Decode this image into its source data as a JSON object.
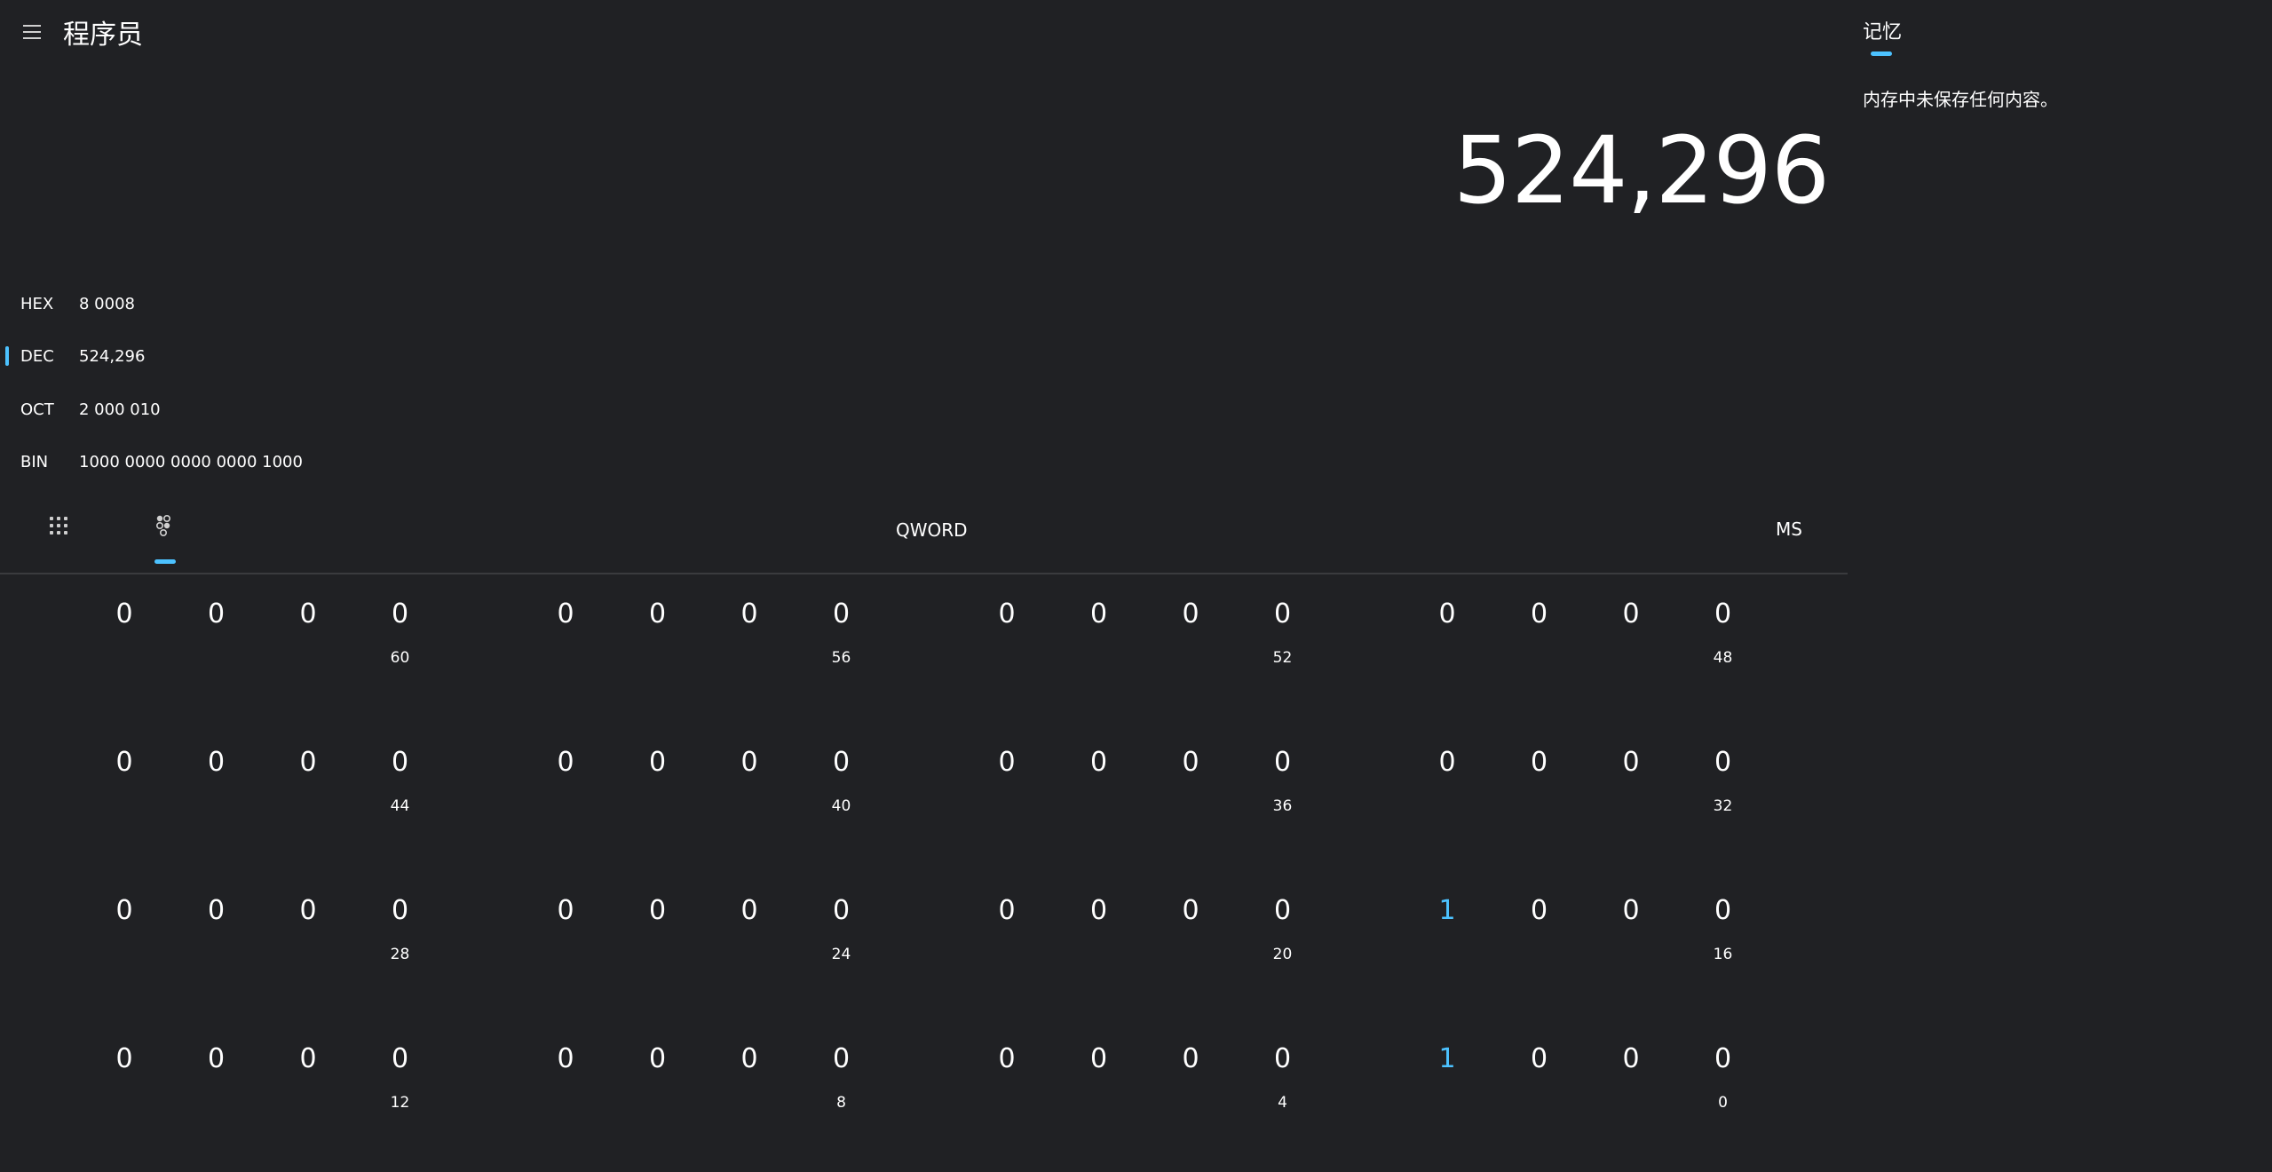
{
  "header": {
    "title": "程序员",
    "menu_icon": "hamburger-menu-icon"
  },
  "display": {
    "value": "524,296"
  },
  "radix": [
    {
      "label": "HEX",
      "value": "8 0008",
      "active": false
    },
    {
      "label": "DEC",
      "value": "524,296",
      "active": true
    },
    {
      "label": "OCT",
      "value": "2 000 010",
      "active": false
    },
    {
      "label": "BIN",
      "value": "1000 0000 0000 0000 1000",
      "active": false
    }
  ],
  "toolbar": {
    "keypad_icon": "full-keypad-icon",
    "bits_icon": "bit-toggling-keypad-icon",
    "word_size": "QWORD",
    "memory_store": "MS"
  },
  "bit_rows": [
    {
      "groups": [
        {
          "bits": [
            "0",
            "0",
            "0",
            "0"
          ],
          "position": "60"
        },
        {
          "bits": [
            "0",
            "0",
            "0",
            "0"
          ],
          "position": "56"
        },
        {
          "bits": [
            "0",
            "0",
            "0",
            "0"
          ],
          "position": "52"
        },
        {
          "bits": [
            "0",
            "0",
            "0",
            "0"
          ],
          "position": "48"
        }
      ]
    },
    {
      "groups": [
        {
          "bits": [
            "0",
            "0",
            "0",
            "0"
          ],
          "position": "44"
        },
        {
          "bits": [
            "0",
            "0",
            "0",
            "0"
          ],
          "position": "40"
        },
        {
          "bits": [
            "0",
            "0",
            "0",
            "0"
          ],
          "position": "36"
        },
        {
          "bits": [
            "0",
            "0",
            "0",
            "0"
          ],
          "position": "32"
        }
      ]
    },
    {
      "groups": [
        {
          "bits": [
            "0",
            "0",
            "0",
            "0"
          ],
          "position": "28"
        },
        {
          "bits": [
            "0",
            "0",
            "0",
            "0"
          ],
          "position": "24"
        },
        {
          "bits": [
            "0",
            "0",
            "0",
            "0"
          ],
          "position": "20"
        },
        {
          "bits": [
            "1",
            "0",
            "0",
            "0"
          ],
          "position": "16"
        }
      ]
    },
    {
      "groups": [
        {
          "bits": [
            "0",
            "0",
            "0",
            "0"
          ],
          "position": "12"
        },
        {
          "bits": [
            "0",
            "0",
            "0",
            "0"
          ],
          "position": "8"
        },
        {
          "bits": [
            "0",
            "0",
            "0",
            "0"
          ],
          "position": "4"
        },
        {
          "bits": [
            "1",
            "0",
            "0",
            "0"
          ],
          "position": "0"
        }
      ]
    }
  ],
  "memory": {
    "title": "记忆",
    "empty_message": "内存中未保存任何内容。"
  },
  "colors": {
    "background": "#202124",
    "accent": "#4cc2ff",
    "text": "#ffffff"
  }
}
